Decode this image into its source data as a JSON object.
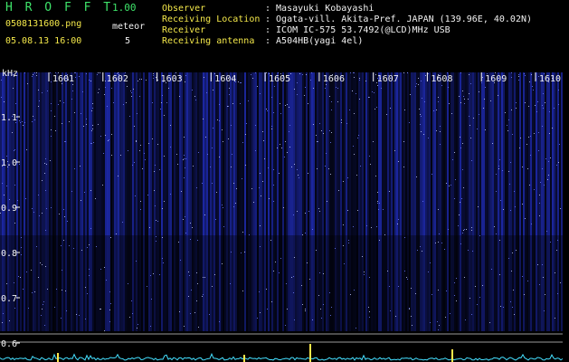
{
  "header": {
    "app_name": "H R O F F T",
    "version": "1.00",
    "filename": "0508131600.png",
    "mode": "meteor",
    "datetime": "05.08.13 16:00",
    "count": "5",
    "info": [
      {
        "label": "Observer",
        "value": ": Masayuki Kobayashi"
      },
      {
        "label": "Receiving Location",
        "value": ": Ogata-vill. Akita-Pref. JAPAN (139.96E, 40.02N)"
      },
      {
        "label": "Receiver",
        "value": ": ICOM IC-575 53.7492(@LCD)MHz USB"
      },
      {
        "label": "Receiving antenna",
        "value": ": A504HB(yagi 4el)"
      }
    ]
  },
  "spectrogram": {
    "freq_unit": "kHz",
    "freq_ticks": [
      "1.1",
      "1.0",
      "0.9",
      "0.8",
      "0.7",
      "0.6"
    ],
    "time_ticks": [
      "1601",
      "1602",
      "1603",
      "1604",
      "1605",
      "1606",
      "1607",
      "1608",
      "1609",
      "1610"
    ]
  },
  "colors": {
    "label_green": "#3ee36a",
    "label_yellow": "#f4e84a",
    "text_white": "#f2f2f2",
    "noise_blue": "#2a3ad8",
    "trace_cyan": "#44e0ff"
  }
}
